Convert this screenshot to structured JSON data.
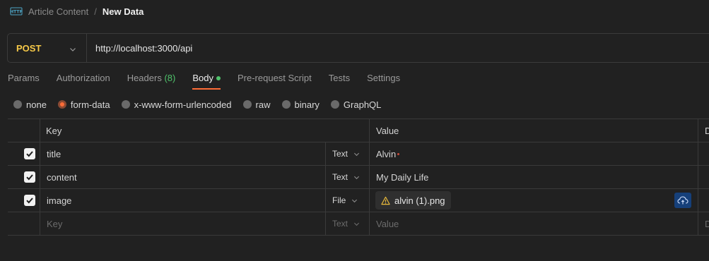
{
  "breadcrumb": {
    "parent": "Article Content",
    "separator": "/",
    "current": "New Data"
  },
  "request": {
    "method": "POST",
    "url": "http://localhost:3000/api"
  },
  "tabs": [
    {
      "label": "Params"
    },
    {
      "label": "Authorization"
    },
    {
      "label": "Headers",
      "count": "(8)"
    },
    {
      "label": "Body",
      "active": true
    },
    {
      "label": "Pre-request Script"
    },
    {
      "label": "Tests"
    },
    {
      "label": "Settings"
    }
  ],
  "body_types": [
    {
      "label": "none"
    },
    {
      "label": "form-data",
      "selected": true
    },
    {
      "label": "x-www-form-urlencoded"
    },
    {
      "label": "raw"
    },
    {
      "label": "binary"
    },
    {
      "label": "GraphQL"
    }
  ],
  "table": {
    "headers": {
      "key": "Key",
      "value": "Value",
      "desc": "D"
    },
    "rows": [
      {
        "checked": true,
        "key": "title",
        "type": "Text",
        "value": "Alvin"
      },
      {
        "checked": true,
        "key": "content",
        "type": "Text",
        "value": "My Daily Life"
      },
      {
        "checked": true,
        "key": "image",
        "type": "File",
        "value": "alvin (1).png"
      }
    ],
    "empty_row": {
      "key_placeholder": "Key",
      "type": "Text",
      "value_placeholder": "Value",
      "desc_placeholder": "D"
    }
  },
  "colors": {
    "accent": "#ff6c37",
    "method": "#f7c948",
    "success": "#4fc36b",
    "upload_button": "#16407a"
  }
}
